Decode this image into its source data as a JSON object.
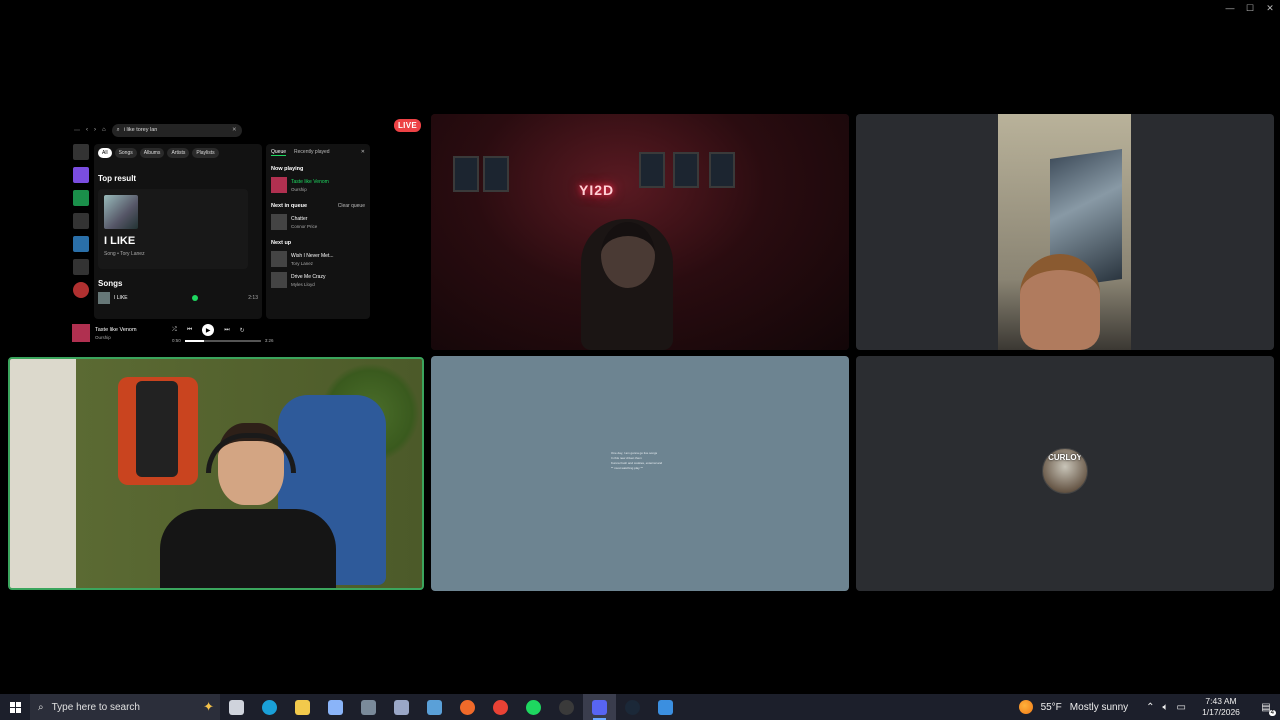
{
  "window": {
    "controls": [
      "—",
      "☐",
      "✕"
    ]
  },
  "stream": {
    "live_label": "LIVE",
    "spotify": {
      "search_value": "i like torey lan",
      "filters": [
        "All",
        "Songs",
        "Albums",
        "Artists",
        "Playlists"
      ],
      "top_result_heading": "Top result",
      "top_result_title": "I LIKE",
      "top_result_sub": "Song • Tory Lanez",
      "songs_heading": "Songs",
      "song_row": {
        "title": "I LIKE",
        "artist": "Tory Lanez",
        "duration": "2:13"
      },
      "queue_tabs": [
        "Queue",
        "Recently played"
      ],
      "now_playing_heading": "Now playing",
      "now_playing": {
        "title": "Taste like Venom",
        "artist": "Ourship"
      },
      "next_in_queue_heading": "Next in queue",
      "clear_queue_label": "Clear queue",
      "queue_item": {
        "title": "Chatter",
        "artist": "Connor Price"
      },
      "next_up_heading": "Next up",
      "next_up": [
        {
          "title": "Wish I Never Met...",
          "artist": "Tory Lanez"
        },
        {
          "title": "Drive Me Crazy",
          "artist": "Myles Lloyd"
        }
      ],
      "player": {
        "title": "Taste like Venom",
        "artist": "Ourship",
        "elapsed": "0:50",
        "total": "3:26",
        "progress": 0.25
      }
    }
  },
  "cam_red": {
    "neon_sign": "YI2D"
  },
  "screen_share": {
    "lines": [
      "One day, I am gonna go live songs",
      "In this new driven them",
      "Kunna fresh and cookies, external and",
      "** must watching play **"
    ]
  },
  "avatar": {
    "text": "CURLOY"
  },
  "taskbar": {
    "search_placeholder": "Type here to search",
    "weather_temp": "55°F",
    "weather_desc": "Mostly sunny",
    "time": "7:43 AM",
    "date": "1/17/2026",
    "notification_count": "4",
    "apps": [
      {
        "name": "task-view",
        "color": "#cfd3dc"
      },
      {
        "name": "edge",
        "color": "#1aa0d8"
      },
      {
        "name": "file-explorer",
        "color": "#f2c94c"
      },
      {
        "name": "control-panel",
        "color": "#8ab4f8"
      },
      {
        "name": "calculator",
        "color": "#7a8a9a"
      },
      {
        "name": "snipping-tool",
        "color": "#9aa7c7"
      },
      {
        "name": "notepad",
        "color": "#5aa0d8"
      },
      {
        "name": "brave",
        "color": "#f06a2a"
      },
      {
        "name": "chrome",
        "color": "#e94235"
      },
      {
        "name": "spotify",
        "color": "#1ed760"
      },
      {
        "name": "obs",
        "color": "#3a3a3a"
      },
      {
        "name": "discord",
        "color": "#5865f2"
      },
      {
        "name": "steam",
        "color": "#1b2838"
      },
      {
        "name": "paint",
        "color": "#3b8fe0"
      }
    ]
  }
}
